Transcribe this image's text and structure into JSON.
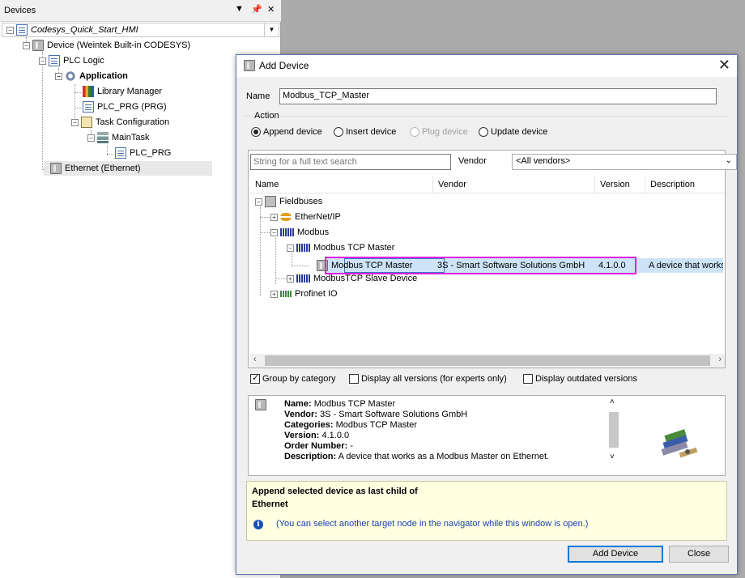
{
  "devices_panel": {
    "title": "Devices",
    "tree": [
      {
        "label": "Codesys_Quick_Start_HMI"
      },
      {
        "label": "Device (Weintek Built-in CODESYS)"
      },
      {
        "label": "PLC Logic"
      },
      {
        "label": "Application"
      },
      {
        "label": "Library Manager"
      },
      {
        "label": "PLC_PRG (PRG)"
      },
      {
        "label": "Task Configuration"
      },
      {
        "label": "MainTask"
      },
      {
        "label": "PLC_PRG"
      },
      {
        "label": "Ethernet (Ethernet)"
      }
    ]
  },
  "dialog": {
    "title": "Add Device",
    "name_label": "Name",
    "name_value": "Modbus_TCP_Master",
    "action_label": "Action",
    "actions": [
      {
        "label": "Append device",
        "selected": true
      },
      {
        "label": "Insert device",
        "selected": false
      },
      {
        "label": "Plug device",
        "selected": false,
        "disabled": true
      },
      {
        "label": "Update device",
        "selected": false
      }
    ],
    "search_placeholder": "String for a full text search",
    "vendor_label": "Vendor",
    "vendor_value": "<All vendors>",
    "columns": [
      "Name",
      "Vendor",
      "Version",
      "Description"
    ],
    "catalog": [
      {
        "label": "Fieldbuses"
      },
      {
        "label": "EtherNet/IP"
      },
      {
        "label": "Modbus"
      },
      {
        "label": "Modbus TCP Master"
      },
      {
        "label": "Modbus TCP Master",
        "vendor": "3S - Smart Software Solutions GmbH",
        "version": "4.1.0.0",
        "description": "A device that works"
      },
      {
        "label": "ModbusTCP Slave Device"
      },
      {
        "label": "Profinet IO"
      }
    ],
    "options": [
      {
        "label": "Group by category",
        "checked": true
      },
      {
        "label": "Display all versions (for experts only)",
        "checked": false
      },
      {
        "label": "Display outdated versions",
        "checked": false
      }
    ],
    "info": {
      "name_key": "Name:",
      "name_val": "Modbus TCP Master",
      "vendor_key": "Vendor:",
      "vendor_val": "3S - Smart Software Solutions GmbH",
      "categories_key": "Categories:",
      "categories_val": "Modbus TCP Master",
      "version_key": "Version:",
      "version_val": "4.1.0.0",
      "order_key": "Order Number:",
      "order_val": "-",
      "desc_key": "Description:",
      "desc_val": "A device that works as a Modbus Master on Ethernet."
    },
    "hint": {
      "line1": "Append selected device as last child of",
      "line2": "Ethernet",
      "line3": "(You can select another target node in the navigator while this window is open.)"
    },
    "add_button": "Add Device",
    "close_button": "Close"
  },
  "colors": {
    "highlight": "#e020e0",
    "selection": "#cde4f8",
    "hint_bg": "#ffffe1"
  }
}
